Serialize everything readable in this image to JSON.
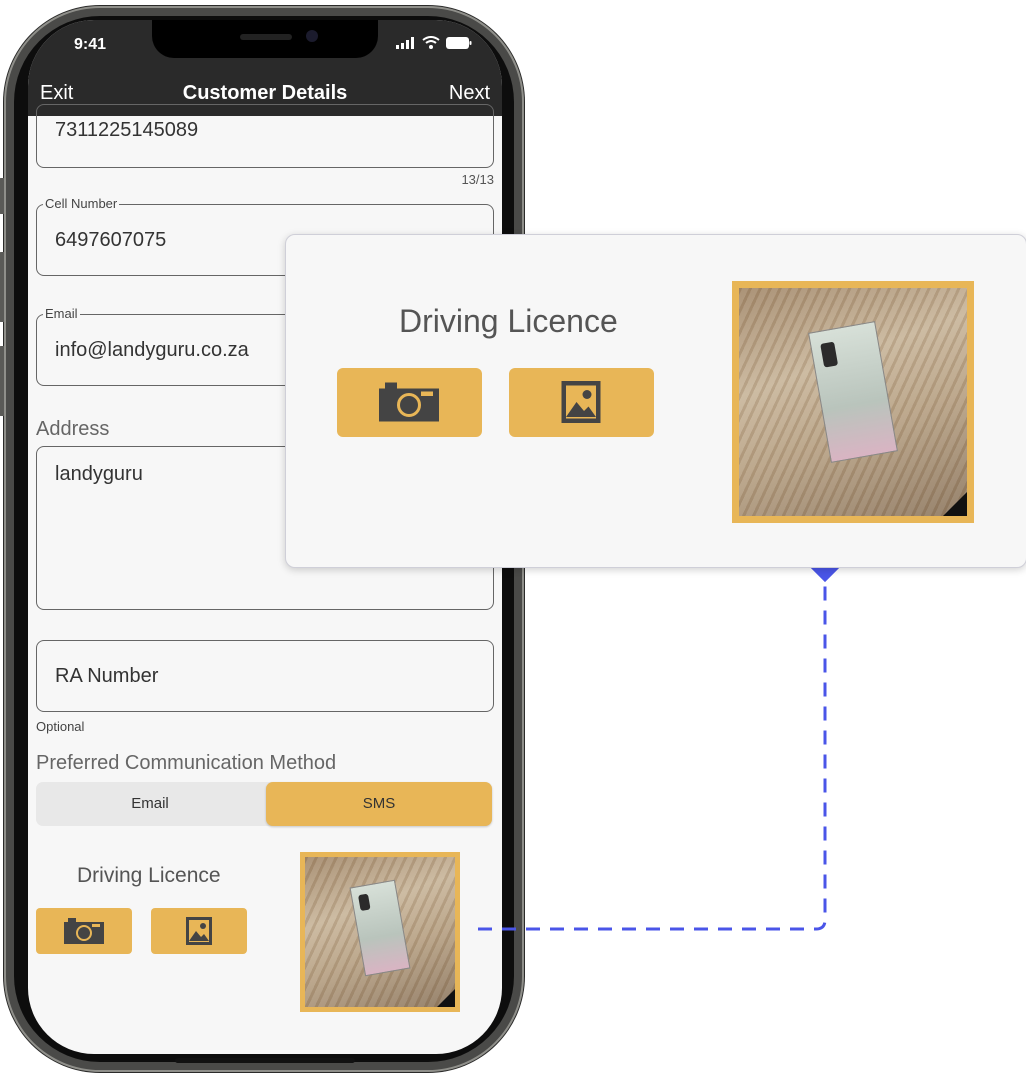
{
  "status": {
    "time": "9:41",
    "icons": [
      "signal-icon",
      "wifi-icon",
      "battery-icon"
    ]
  },
  "nav": {
    "exit": "Exit",
    "title": "Customer Details",
    "next": "Next"
  },
  "form": {
    "id_number": {
      "value": "7311225145089",
      "counter": "13/13"
    },
    "cell": {
      "legend": "Cell Number",
      "value": "6497607075"
    },
    "email": {
      "legend": "Email",
      "value": "info@landyguru.co.za"
    },
    "address": {
      "label": "Address",
      "value": "landyguru"
    },
    "ra_number": {
      "placeholder": "RA Number",
      "note": "Optional"
    },
    "communication": {
      "label": "Preferred Communication Method",
      "options": [
        "Email",
        "SMS"
      ],
      "selected": "SMS"
    }
  },
  "licence": {
    "title": "Driving Licence",
    "camera_icon": "camera-icon",
    "gallery_icon": "image-gallery-icon"
  },
  "callout": {
    "title": "Driving Licence"
  },
  "colors": {
    "accent": "#e8b657",
    "nav_bg": "#2a2a2a",
    "connector": "#4a55e8"
  }
}
